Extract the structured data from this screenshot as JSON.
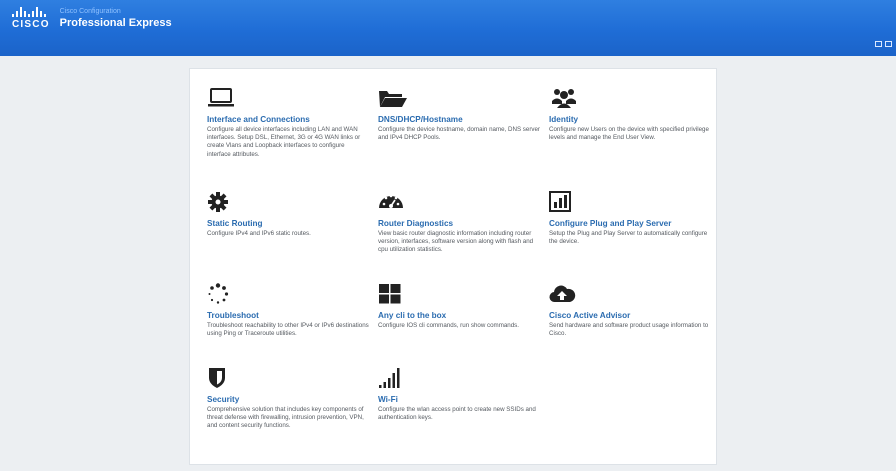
{
  "header": {
    "brand": "CISCO",
    "subtitle": "Cisco Configuration",
    "product": "Professional Express",
    "colors": {
      "bar": "#1f6dd6",
      "link": "#2b6cb0"
    }
  },
  "tiles": [
    {
      "icon": "laptop-icon",
      "title": "Interface and Connections",
      "desc": "Configure all device interfaces including LAN and WAN interfaces. Setup DSL, Ethernet, 3G or 4G WAN links or create Vlans and Loopback interfaces to configure interface attributes."
    },
    {
      "icon": "folder-icon",
      "title": "DNS/DHCP/Hostname",
      "desc": "Configure the device hostname, domain name, DNS server and IPv4 DHCP Pools."
    },
    {
      "icon": "users-icon",
      "title": "Identity",
      "desc": "Configure new Users on the device with specified privilege levels and manage the End User View."
    },
    {
      "icon": "gear-icon",
      "title": "Static Routing",
      "desc": "Configure IPv4 and IPv6 static routes."
    },
    {
      "icon": "dashboard-icon",
      "title": "Router Diagnostics",
      "desc": "View basic router diagnostic information including router version, interfaces, software version along with flash and cpu utilization statistics."
    },
    {
      "icon": "bar-chart-icon",
      "title": "Configure Plug and Play Server",
      "desc": "Setup the Plug and Play Server to automatically configure the device."
    },
    {
      "icon": "spinner-icon",
      "title": "Troubleshoot",
      "desc": "Troubleshoot reachability to other IPv4 or IPv6 destinations using Ping or Traceroute utilities."
    },
    {
      "icon": "grid-icon",
      "title": "Any cli to the box",
      "desc": "Configure IOS cli commands, run show commands."
    },
    {
      "icon": "cloud-upload-icon",
      "title": "Cisco Active Advisor",
      "desc": "Send hardware and software product usage information to Cisco."
    },
    {
      "icon": "shield-icon",
      "title": "Security",
      "desc": "Comprehensive solution that includes key components of threat defense with firewalling, intrusion prevention, VPN, and content security functions."
    },
    {
      "icon": "signal-icon",
      "title": "Wi-Fi",
      "desc": "Configure the wlan access point to create new SSIDs and authentication keys."
    }
  ]
}
